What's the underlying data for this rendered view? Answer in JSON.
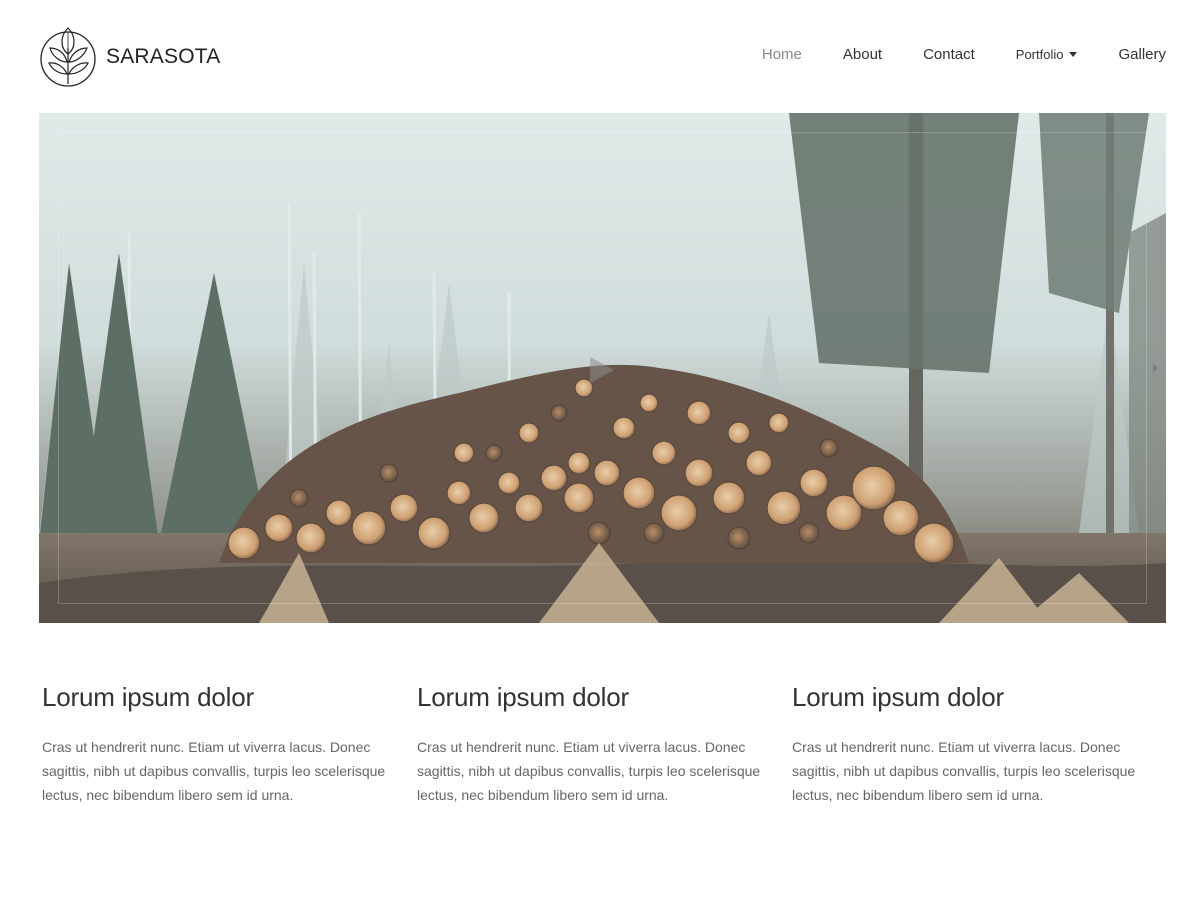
{
  "brand": {
    "name": "SARASOTA",
    "logo_icon": "leaf-circle-icon"
  },
  "nav": {
    "items": [
      {
        "label": "Home",
        "active": true
      },
      {
        "label": "About",
        "active": false
      },
      {
        "label": "Contact",
        "active": false
      },
      {
        "label": "Portfolio",
        "active": false,
        "has_dropdown": true
      },
      {
        "label": "Gallery",
        "active": false
      }
    ]
  },
  "hero": {
    "image_subject": "stacked logs in a foggy forest",
    "play_icon": "play-icon",
    "next_icon": "chevron-right-icon"
  },
  "features": [
    {
      "title": "Lorum ipsum dolor",
      "text": "Cras ut hendrerit nunc. Etiam ut viverra lacus. Donec sagittis, nibh ut dapibus convallis, turpis leo scelerisque lectus, nec bibendum libero sem id urna."
    },
    {
      "title": "Lorum ipsum dolor",
      "text": "Cras ut hendrerit nunc. Etiam ut viverra lacus. Donec sagittis, nibh ut dapibus convallis, turpis leo scelerisque lectus, nec bibendum libero sem id urna."
    },
    {
      "title": "Lorum ipsum dolor",
      "text": "Cras ut hendrerit nunc. Etiam ut viverra lacus. Donec sagittis, nibh ut dapibus convallis, turpis leo scelerisque lectus, nec bibendum libero sem id urna."
    }
  ],
  "colors": {
    "text_dark": "#333333",
    "nav_active": "#8a8a8a",
    "body_text": "#666666",
    "background": "#ffffff"
  }
}
